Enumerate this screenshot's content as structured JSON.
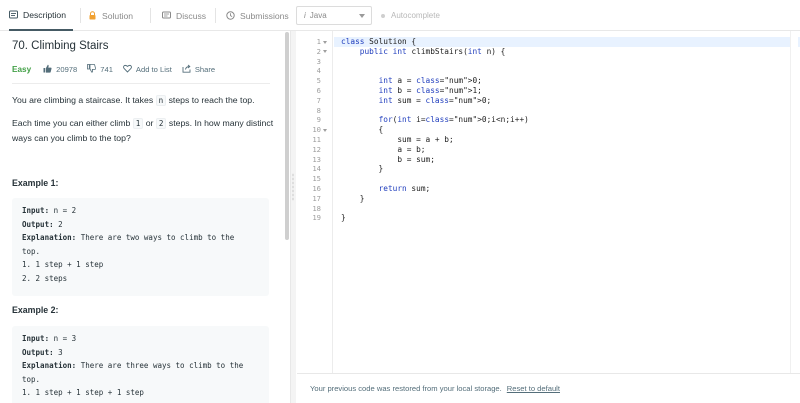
{
  "tabs": [
    {
      "label": "Description",
      "icon": "description-icon"
    },
    {
      "label": "Solution",
      "icon": "lock-icon"
    },
    {
      "label": "Discuss",
      "icon": "discuss-icon"
    },
    {
      "label": "Submissions",
      "icon": "history-icon"
    }
  ],
  "editor_toolbar": {
    "language_prefix": "i",
    "language": "Java",
    "autocomplete_label": "Autocomplete"
  },
  "problem": {
    "title": "70. Climbing Stairs",
    "difficulty": "Easy",
    "likes": "20978",
    "dislikes": "741",
    "add_to_list": "Add to List",
    "share": "Share",
    "p1_before": "You are climbing a staircase. It takes ",
    "p1_code": "n",
    "p1_after": " steps to reach the top.",
    "p2_before": "Each time you can either climb ",
    "p2_code1": "1",
    "p2_mid": " or ",
    "p2_code2": "2",
    "p2_after": " steps. In how many distinct ways can you climb to the top?",
    "examples": [
      {
        "heading": "Example 1:",
        "input_label": "Input:",
        "input_value": " n = 2",
        "output_label": "Output:",
        "output_value": " 2",
        "explanation_label": "Explanation:",
        "explanation_value": " There are two ways to climb to the",
        "explanation_cont": "top.",
        "steps": [
          "1. 1 step + 1 step",
          "2. 2 steps"
        ]
      },
      {
        "heading": "Example 2:",
        "input_label": "Input:",
        "input_value": " n = 3",
        "output_label": "Output:",
        "output_value": " 3",
        "explanation_label": "Explanation:",
        "explanation_value": " There are three ways to climb to the",
        "explanation_cont": "top.",
        "steps": [
          "1. 1 step + 1 step + 1 step"
        ]
      }
    ]
  },
  "code": {
    "line_numbers": [
      "1",
      "2",
      "3",
      "4",
      "5",
      "6",
      "7",
      "8",
      "9",
      "10",
      "11",
      "12",
      "13",
      "14",
      "15",
      "16",
      "17",
      "18",
      "19"
    ],
    "lines": [
      "class Solution {",
      "    public int climbStairs(int n) {",
      "",
      "",
      "        int a = 0;",
      "        int b = 1;",
      "        int sum = 0;",
      "",
      "        for(int i=0;i<n;i++)",
      "        {",
      "            sum = a + b;",
      "            a = b;",
      "            b = sum;",
      "        }",
      "",
      "        return sum;",
      "    }",
      "",
      "}"
    ]
  },
  "footer": {
    "message": "Your previous code was restored from your local storage.",
    "reset_link": "Reset to default"
  }
}
